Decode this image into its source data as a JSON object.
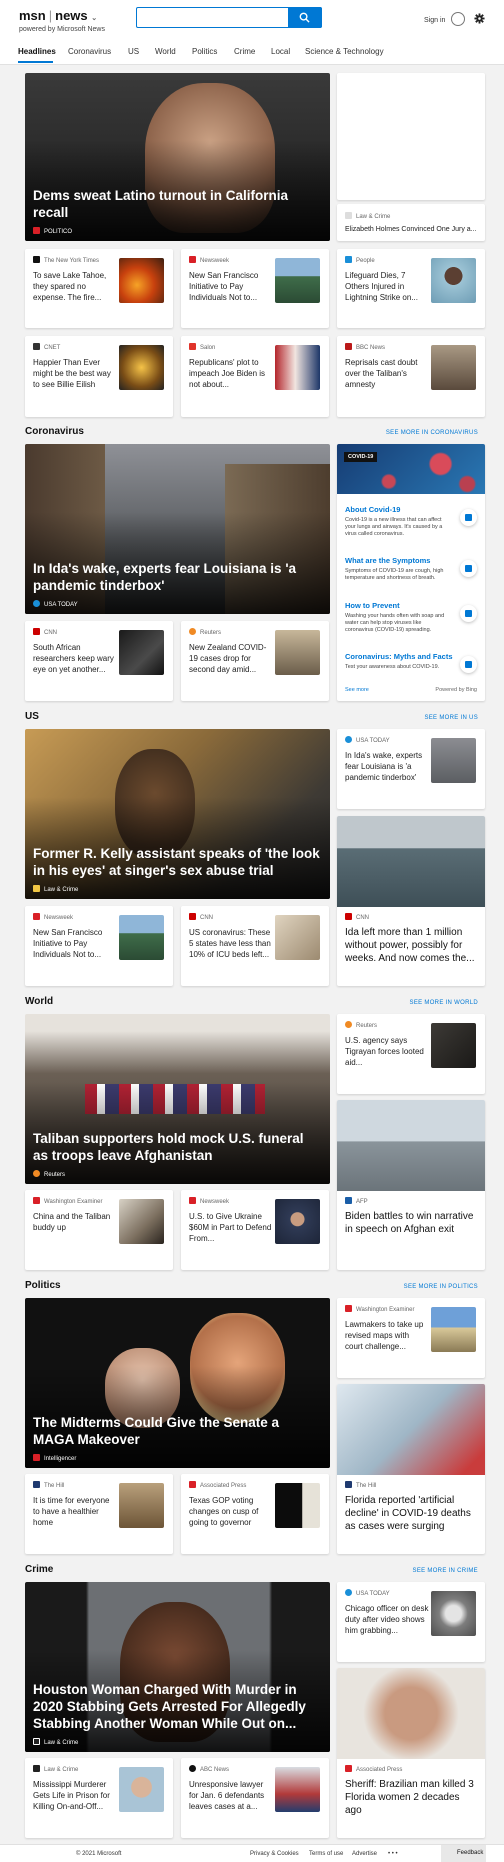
{
  "header": {
    "logo": "msn",
    "section": "news",
    "powered": "powered by Microsoft News",
    "search_placeholder": "",
    "sign_in": "Sign in"
  },
  "nav": [
    "Headlines",
    "Coronavirus",
    "US",
    "World",
    "Politics",
    "Crime",
    "Local",
    "Science & Technology"
  ],
  "top": {
    "hero": {
      "title": "Dems sweat Latino turnout in California recall",
      "source": "POLITICO"
    },
    "side": {
      "source": "Law & Crime",
      "title": "Elizabeth Holmes Convinced One Jury a..."
    },
    "row1": [
      {
        "source": "The New York Times",
        "title": "To save Lake Tahoe, they spared no expense. The fire..."
      },
      {
        "source": "Newsweek",
        "title": "New San Francisco Initiative to Pay Individuals Not to..."
      },
      {
        "source": "People",
        "title": "Lifeguard Dies, 7 Others Injured in Lightning Strike on..."
      }
    ],
    "row2": [
      {
        "source": "CNET",
        "title": "Happier Than Ever might be the best way to see Billie Eilish"
      },
      {
        "source": "Salon",
        "title": "Republicans' plot to impeach Joe Biden is not about..."
      },
      {
        "source": "BBC News",
        "title": "Reprisals cast doubt over the Taliban's amnesty"
      }
    ]
  },
  "sections": {
    "coronavirus": {
      "title": "Coronavirus",
      "see_more": "SEE MORE IN CORONAVIRUS",
      "hero": {
        "title": "In Ida's wake, experts fear Louisiana is 'a pandemic tinderbox'",
        "source": "USA TODAY"
      },
      "cards": [
        {
          "source": "CNN",
          "title": "South African researchers keep wary eye on yet another..."
        },
        {
          "source": "Reuters",
          "title": "New Zealand COVID-19 cases drop for second day amid..."
        }
      ],
      "covid": {
        "tag": "COVID-19",
        "items": [
          {
            "h": "About Covid-19",
            "d": "Covid-19 is a new illness that can affect your lungs and airways. It's caused by a virus called coronavirus."
          },
          {
            "h": "What are the Symptoms",
            "d": "Symptoms of COVID-19 are cough, high temperature and shortness of breath."
          },
          {
            "h": "How to Prevent",
            "d": "Washing your hands often with soap and water can help stop viruses like coronavirus (COVID-19) spreading."
          },
          {
            "h": "Coronavirus: Myths and Facts",
            "d": "Test your awareness about COVID-19."
          }
        ],
        "see_more": "See more",
        "powered": "Powered by Bing"
      }
    },
    "us": {
      "title": "US",
      "see_more": "SEE MORE IN US",
      "hero": {
        "title": "Former R. Kelly assistant speaks of 'the look in his eyes' at singer's sex abuse trial",
        "source": "Law & Crime"
      },
      "side": {
        "source": "USA TODAY",
        "title": "In Ida's wake, experts fear Louisiana is 'a pandemic tinderbox'"
      },
      "cards": [
        {
          "source": "Newsweek",
          "title": "New San Francisco Initiative to Pay Individuals Not to..."
        },
        {
          "source": "CNN",
          "title": "US coronavirus: These 5 states have less than 10% of ICU beds left..."
        }
      ],
      "tall": {
        "source": "CNN",
        "title": "Ida left more than 1 million without power, possibly for weeks. And now comes the..."
      }
    },
    "world": {
      "title": "World",
      "see_more": "SEE MORE IN WORLD",
      "hero": {
        "title": "Taliban supporters hold mock U.S. funeral as troops leave Afghanistan",
        "source": "Reuters"
      },
      "side": {
        "source": "Reuters",
        "title": "U.S. agency says Tigrayan forces looted aid..."
      },
      "cards": [
        {
          "source": "Washington Examiner",
          "title": "China and the Taliban buddy up"
        },
        {
          "source": "Newsweek",
          "title": "U.S. to Give Ukraine $60M in Part to Defend From..."
        }
      ],
      "tall": {
        "source": "AFP",
        "title": "Biden battles to win narrative in speech on Afghan exit"
      }
    },
    "politics": {
      "title": "Politics",
      "see_more": "SEE MORE IN POLITICS",
      "hero": {
        "title": "The Midterms Could Give the Senate a MAGA Makeover",
        "source": "Intelligencer"
      },
      "side": {
        "source": "Washington Examiner",
        "title": "Lawmakers to take up revised maps with court challenge..."
      },
      "cards": [
        {
          "source": "The Hill",
          "title": "It is time for everyone to have a healthier home"
        },
        {
          "source": "Associated Press",
          "title": "Texas GOP voting changes on cusp of going to governor"
        }
      ],
      "tall": {
        "source": "The Hill",
        "title": "Florida reported 'artificial decline' in COVID-19 deaths as cases were surging"
      }
    },
    "crime": {
      "title": "Crime",
      "see_more": "SEE MORE IN CRIME",
      "hero": {
        "title": "Houston Woman Charged With Murder in 2020 Stabbing Gets Arrested For Allegedly Stabbing Another Woman While Out on...",
        "source": "Law & Crime"
      },
      "side": {
        "source": "USA TODAY",
        "title": "Chicago officer on desk duty after video shows him grabbing..."
      },
      "cards": [
        {
          "source": "Law & Crime",
          "title": "Mississippi Murderer Gets Life in Prison for Killing On-and-Off..."
        },
        {
          "source": "ABC News",
          "title": "Unresponsive lawyer for Jan. 6 defendants leaves cases at a..."
        }
      ],
      "tall": {
        "source": "Associated Press",
        "title": "Sheriff: Brazilian man killed 3 Florida women 2 decades ago"
      }
    }
  },
  "footer": {
    "copyright": "© 2021 Microsoft",
    "privacy": "Privacy & Cookies",
    "terms": "Terms of use",
    "advertise": "Advertise",
    "more": "• • •",
    "feedback": "Feedback"
  }
}
